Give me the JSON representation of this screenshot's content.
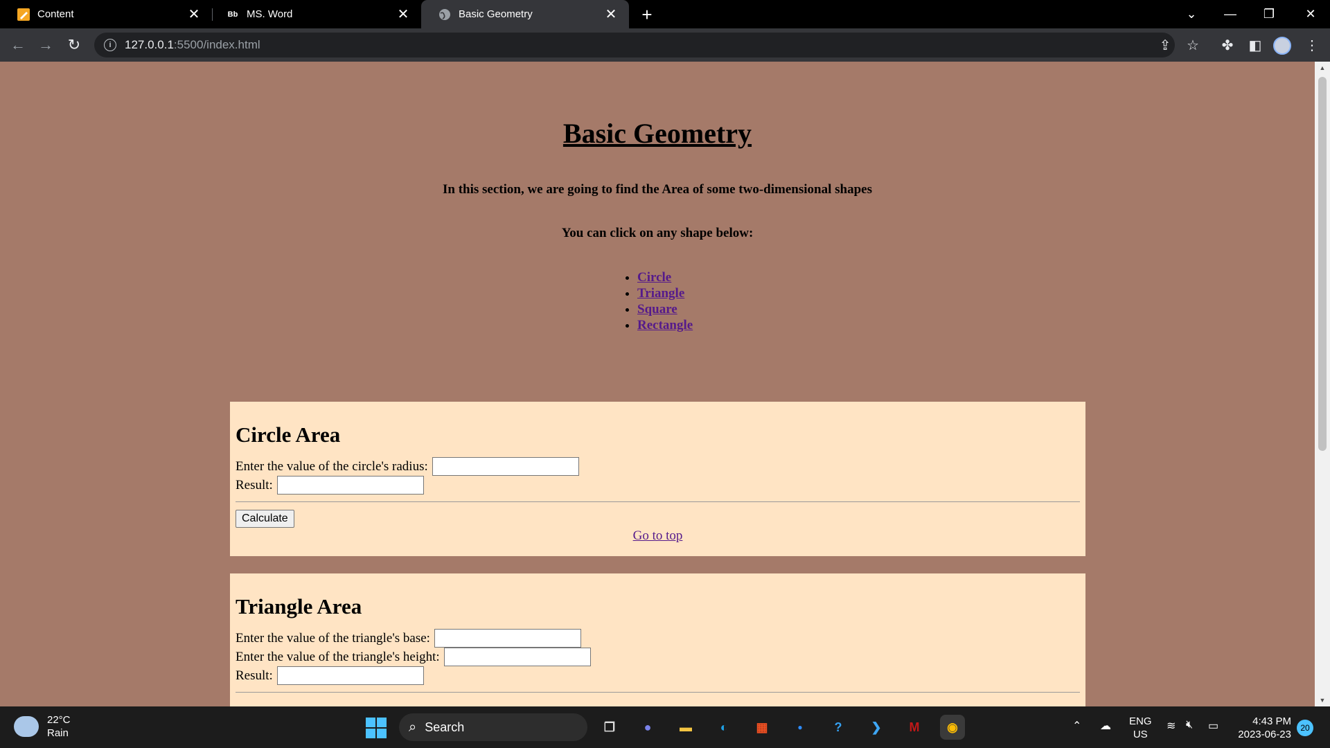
{
  "browser": {
    "tabs": [
      {
        "label": "Content",
        "favicon": "pencil-note-icon",
        "active": false
      },
      {
        "label": "MS. Word",
        "favicon_text": "Bb",
        "active": false
      },
      {
        "label": "Basic Geometry",
        "favicon": "globe-icon",
        "active": true
      }
    ],
    "url_host": "127.0.0.1",
    "url_rest": ":5500/index.html"
  },
  "page": {
    "title": "Basic Geometry",
    "intro": "In this section, we are going to find the Area of some two-dimensional shapes",
    "prompt": "You can click on any shape below:",
    "shapes": [
      "Circle",
      "Triangle",
      "Square",
      "Rectangle"
    ],
    "circle": {
      "heading": "Circle Area",
      "radius_label": "Enter the value of the circle's radius:",
      "radius_value": "",
      "result_label": "Result:",
      "result_value": "",
      "calculate_label": "Calculate",
      "gotop_label": "Go to top"
    },
    "triangle": {
      "heading": "Triangle Area",
      "base_label": "Enter the value of the triangle's base:",
      "base_value": "",
      "height_label": "Enter the value of the triangle's height:",
      "height_value": "",
      "result_label": "Result:",
      "result_value": ""
    }
  },
  "taskbar": {
    "temperature": "22°C",
    "condition": "Rain",
    "search_label": "Search",
    "lang_top": "ENG",
    "lang_bottom": "US",
    "time": "4:43 PM",
    "date": "2023-06-23",
    "notification_count": "20"
  },
  "colors": {
    "page_background": "#a57a69",
    "card_background": "#ffe4c4",
    "link_visited": "#551a8b"
  }
}
